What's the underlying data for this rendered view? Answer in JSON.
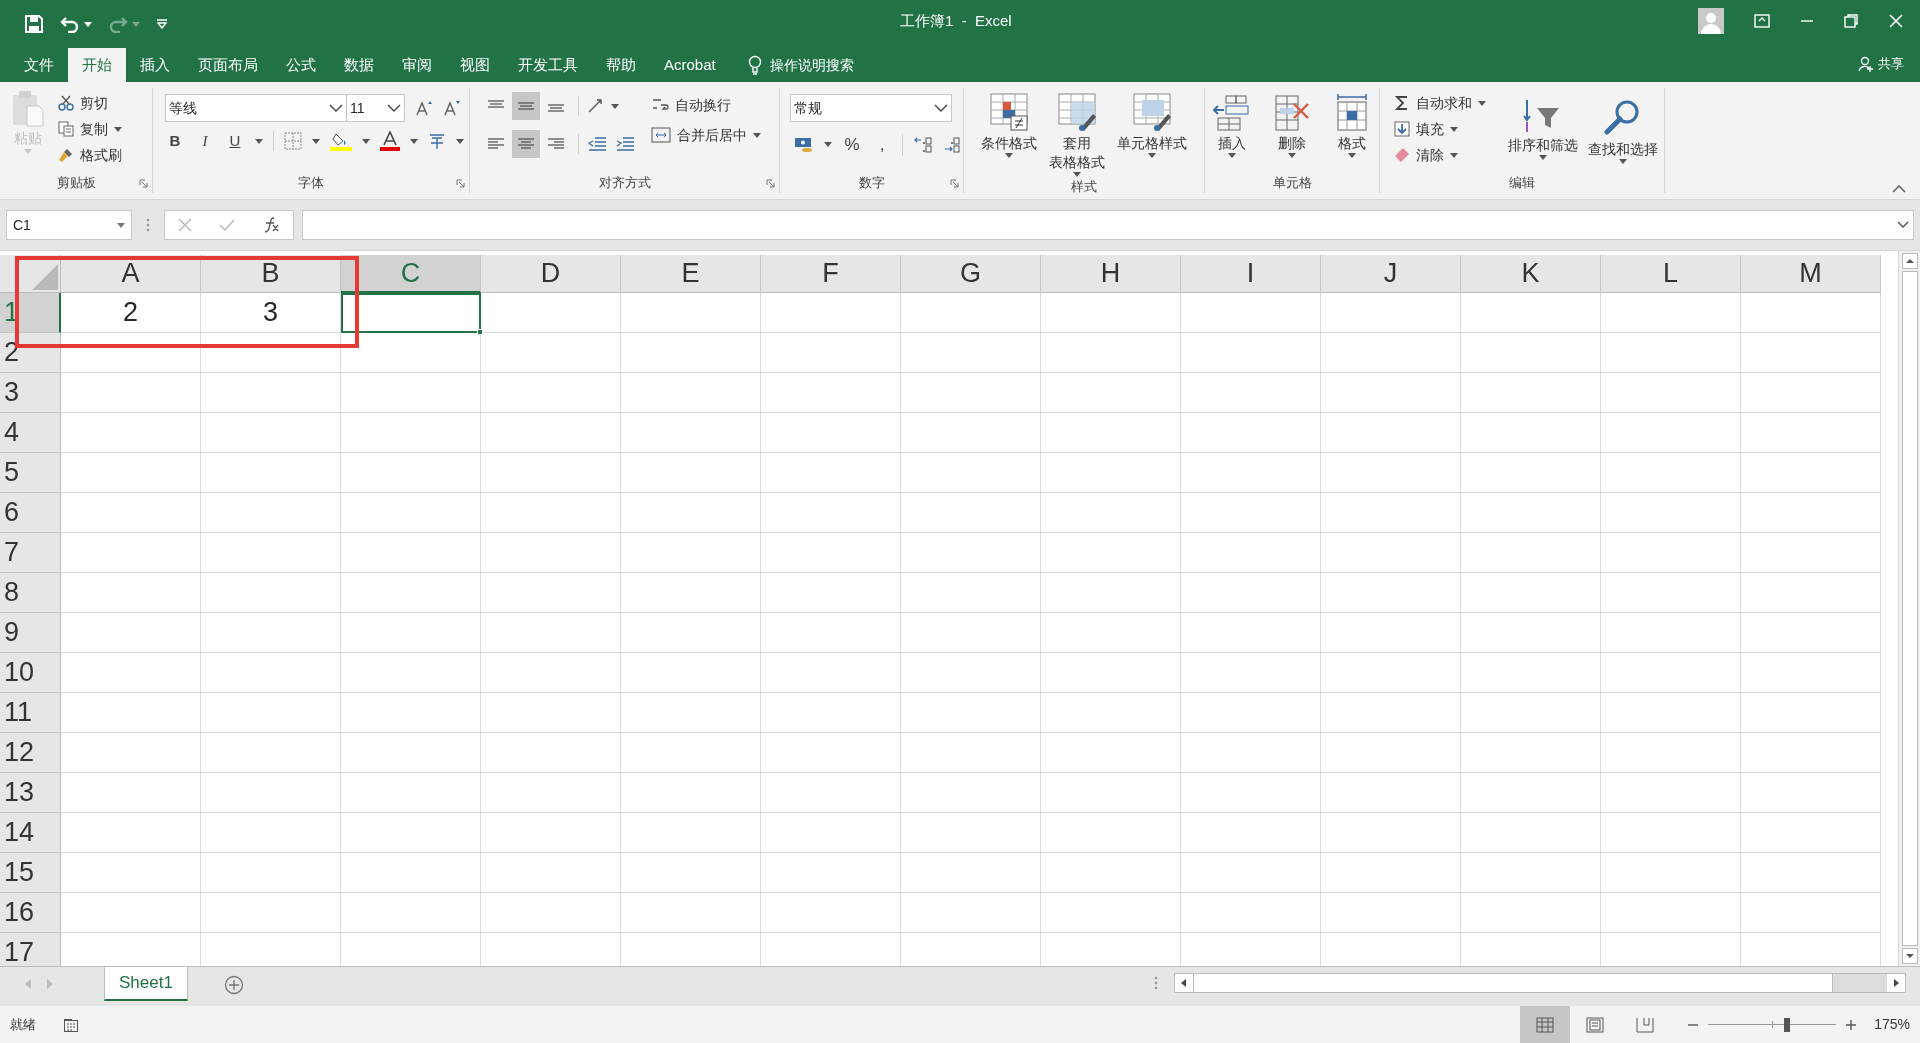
{
  "window": {
    "title": "工作簿1  -  Excel",
    "share": "共享"
  },
  "menu_tabs": [
    {
      "label": "文件",
      "selected": false
    },
    {
      "label": "开始",
      "selected": true
    },
    {
      "label": "插入",
      "selected": false
    },
    {
      "label": "页面布局",
      "selected": false
    },
    {
      "label": "公式",
      "selected": false
    },
    {
      "label": "数据",
      "selected": false
    },
    {
      "label": "审阅",
      "selected": false
    },
    {
      "label": "视图",
      "selected": false
    },
    {
      "label": "开发工具",
      "selected": false
    },
    {
      "label": "帮助",
      "selected": false
    },
    {
      "label": "Acrobat",
      "selected": false
    }
  ],
  "tell_me": "操作说明搜索",
  "ribbon": {
    "clipboard": {
      "label": "剪贴板",
      "paste": "粘贴",
      "items": [
        "剪切",
        "复制",
        "格式刷"
      ]
    },
    "font": {
      "label": "字体",
      "font_name": "等线",
      "font_size": "11",
      "format_buttons": [
        "B",
        "I",
        "U"
      ]
    },
    "alignment": {
      "label": "对齐方式",
      "vertical_align": [
        {
          "selected": false
        },
        {
          "selected": true
        },
        {
          "selected": false
        }
      ],
      "horizontal_align": [
        {
          "selected": false
        },
        {
          "selected": true
        },
        {
          "selected": false
        }
      ],
      "wrap": "自动换行",
      "merge": "合并后居中"
    },
    "number": {
      "label": "数字",
      "format": "常规",
      "buttons": [
        "%",
        ","
      ]
    },
    "styles": {
      "label": "样式",
      "buttons": [
        {
          "lines": [
            "条件格式"
          ]
        },
        {
          "lines": [
            "套用",
            "表格格式"
          ]
        },
        {
          "lines": [
            "单元格样式"
          ]
        }
      ]
    },
    "cells": {
      "label": "单元格",
      "buttons": [
        "插入",
        "删除",
        "格式"
      ]
    },
    "editing": {
      "label": "编辑",
      "items": [
        "自动求和",
        "填充",
        "清除"
      ],
      "buttons": [
        "排序和筛选",
        "查找和选择"
      ]
    }
  },
  "formula_bar": {
    "name_box": "C1"
  },
  "grid": {
    "columns": [
      {
        "label": "A",
        "selected": false
      },
      {
        "label": "B",
        "selected": false
      },
      {
        "label": "C",
        "selected": true
      },
      {
        "label": "D",
        "selected": false
      },
      {
        "label": "E",
        "selected": false
      },
      {
        "label": "F",
        "selected": false
      },
      {
        "label": "G",
        "selected": false
      },
      {
        "label": "H",
        "selected": false
      },
      {
        "label": "I",
        "selected": false
      },
      {
        "label": "J",
        "selected": false
      },
      {
        "label": "K",
        "selected": false
      },
      {
        "label": "L",
        "selected": false
      },
      {
        "label": "M",
        "selected": false
      }
    ],
    "rows": [
      {
        "label": "1",
        "selected": true,
        "cells": [
          "2",
          "3"
        ]
      },
      {
        "label": "2",
        "selected": false
      },
      {
        "label": "3",
        "selected": false
      },
      {
        "label": "4",
        "selected": false
      },
      {
        "label": "5",
        "selected": false
      },
      {
        "label": "6",
        "selected": false
      },
      {
        "label": "7",
        "selected": false
      },
      {
        "label": "8",
        "selected": false
      },
      {
        "label": "9",
        "selected": false
      },
      {
        "label": "10",
        "selected": false
      },
      {
        "label": "11",
        "selected": false
      },
      {
        "label": "12",
        "selected": false
      },
      {
        "label": "13",
        "selected": false
      },
      {
        "label": "14",
        "selected": false
      },
      {
        "label": "15",
        "selected": false
      },
      {
        "label": "16",
        "selected": false
      },
      {
        "label": "17",
        "selected": false
      }
    ],
    "annotations": [
      {
        "kind": "rectangle"
      }
    ]
  },
  "sheet_tabs": [
    {
      "label": "Sheet1",
      "selected": true
    }
  ],
  "status_bar": {
    "status": "就绪",
    "view_modes": [
      {
        "kind": "normal",
        "selected": true
      },
      {
        "kind": "page-layout",
        "selected": false
      },
      {
        "kind": "page-break",
        "selected": false
      }
    ],
    "zoom": {
      "level": 0.62,
      "reading": "175%"
    }
  }
}
